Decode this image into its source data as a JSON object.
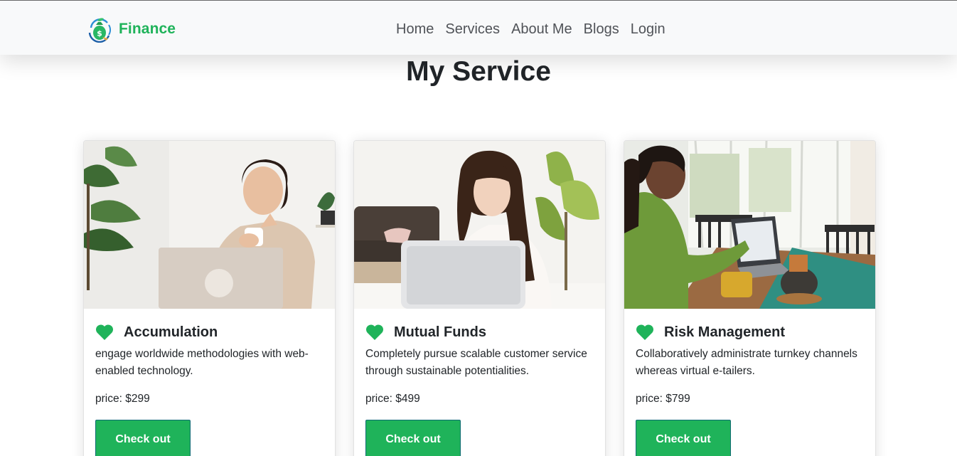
{
  "brand": {
    "name": "Finance",
    "logo_icon": "money-bag-icon",
    "color": "#1fb35a"
  },
  "nav": {
    "items": [
      {
        "label": "Home"
      },
      {
        "label": "Services"
      },
      {
        "label": "About Me"
      },
      {
        "label": "Blogs"
      },
      {
        "label": "Login"
      }
    ]
  },
  "page": {
    "title": "My Service"
  },
  "services": [
    {
      "title": "Accumulation",
      "description": "engage worldwide methodologies with web-enabled technology.",
      "price": "price: $299",
      "button": "Check out",
      "image": "woman-with-laptop-and-coffee-photo"
    },
    {
      "title": "Mutual Funds",
      "description": "Completely pursue scalable customer service through sustainable potentialities.",
      "price": "price: $499",
      "button": "Check out",
      "image": "woman-behind-laptop-photo"
    },
    {
      "title": "Risk Management",
      "description": "Collaboratively administrate turnkey channels whereas virtual e-tailers.",
      "price": "price: $799",
      "button": "Check out",
      "image": "woman-pointing-at-laptop-photo"
    }
  ],
  "colors": {
    "accent": "#1fb35a",
    "navbar_bg": "#f8f9fa",
    "text": "#212529"
  }
}
